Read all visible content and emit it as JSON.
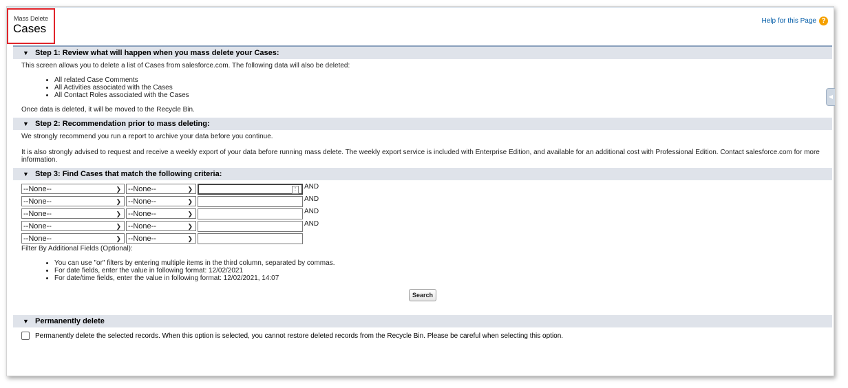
{
  "header": {
    "title_small": "Mass Delete",
    "title_big": "Cases",
    "help_link": "Help for this Page",
    "help_icon": "?"
  },
  "step1": {
    "heading": "Step 1: Review what will happen when you mass delete your Cases:",
    "intro": "This screen allows you to delete a list of Cases from salesforce.com. The following data will also be deleted:",
    "items": [
      "All related Case Comments",
      "All Activities associated with the Cases",
      "All Contact Roles associated with the Cases"
    ],
    "outro": "Once data is deleted, it will be moved to the Recycle Bin."
  },
  "step2": {
    "heading": "Step 2: Recommendation prior to mass deleting:",
    "p1": "We strongly recommend you run a report to archive your data before you continue.",
    "p2": "It is also strongly advised to request and receive a weekly export of your data before running mass delete. The weekly export service is included with Enterprise Edition, and available for an additional cost with Professional Edition. Contact salesforce.com for more information."
  },
  "step3": {
    "heading": "Step 3: Find Cases that match the following criteria:",
    "field_value": "--None--",
    "operator_value": "--None--",
    "and_label": "AND",
    "filter_label": "Filter By Additional Fields (Optional):",
    "tips": [
      "You can use \"or\" filters by entering multiple items in the third column, separated by commas.",
      "For date fields, enter the value in following format: 12/02/2021",
      "For date/time fields, enter the value in following format: 12/02/2021, 14:07"
    ],
    "search_button": "Search"
  },
  "permanent": {
    "heading": "Permanently delete",
    "checkbox_label": "Permanently delete the selected records. When this option is selected, you cannot restore deleted records from the Recycle Bin. Please be careful when selecting this option."
  },
  "icons": {
    "collapse": "triangle-down-icon",
    "dropdown": "chevron-down-icon",
    "lookup": "lookup-icon",
    "help": "help-icon",
    "side": "sidebar-toggle-icon"
  }
}
